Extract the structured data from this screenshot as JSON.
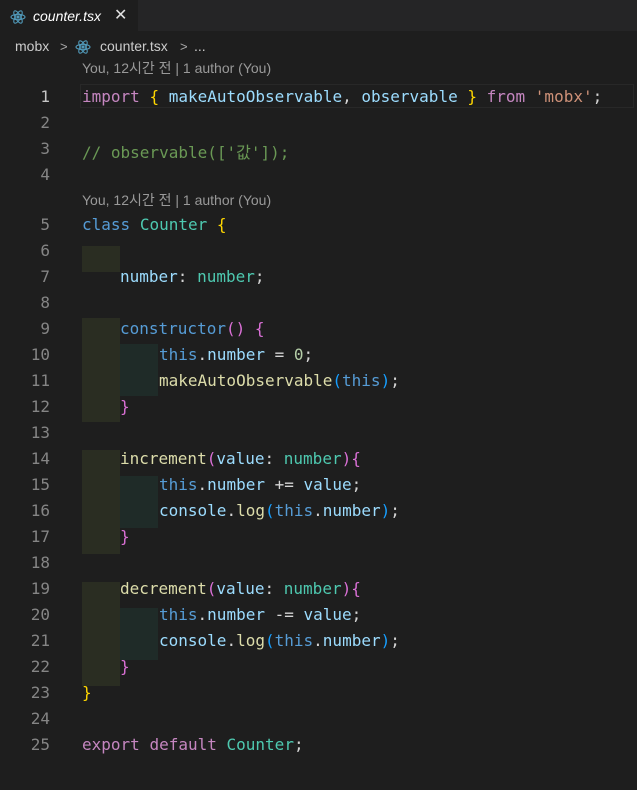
{
  "tab": {
    "label": "counter.tsx",
    "icon": "react-icon",
    "close": "✕"
  },
  "breadcrumb": {
    "folder": "mobx",
    "file": "counter.tsx",
    "more": "...",
    "sep": ">"
  },
  "codelens": "You, 12시간 전 | 1 author (You)",
  "lines": {
    "1": {
      "num": "1",
      "t": [
        "import",
        " ",
        "{",
        " ",
        "makeAutoObservable",
        ", ",
        "observable",
        " ",
        "}",
        " ",
        "from",
        " ",
        "'mobx'",
        ";"
      ]
    },
    "2": {
      "num": "2"
    },
    "3": {
      "num": "3",
      "t": [
        "// observable(['값']);"
      ]
    },
    "4": {
      "num": "4"
    },
    "5": {
      "num": "5",
      "t": [
        "class",
        " ",
        "Counter",
        " ",
        "{"
      ]
    },
    "6": {
      "num": "6"
    },
    "7": {
      "num": "7",
      "t": [
        "number",
        ": ",
        "number",
        ";"
      ]
    },
    "8": {
      "num": "8"
    },
    "9": {
      "num": "9",
      "t": [
        "constructor",
        "()",
        " ",
        "{"
      ]
    },
    "10": {
      "num": "10",
      "t": [
        "this",
        ".",
        "number",
        " = ",
        "0",
        ";"
      ]
    },
    "11": {
      "num": "11",
      "t": [
        "makeAutoObservable",
        "(",
        "this",
        ")",
        ";"
      ]
    },
    "12": {
      "num": "12",
      "t": [
        "}"
      ]
    },
    "13": {
      "num": "13"
    },
    "14": {
      "num": "14",
      "t": [
        "increment",
        "(",
        "value",
        ": ",
        "number",
        ")",
        "{"
      ]
    },
    "15": {
      "num": "15",
      "t": [
        "this",
        ".",
        "number",
        " += ",
        "value",
        ";"
      ]
    },
    "16": {
      "num": "16",
      "t": [
        "console",
        ".",
        "log",
        "(",
        "this",
        ".",
        "number",
        ")",
        ";"
      ]
    },
    "17": {
      "num": "17",
      "t": [
        "}"
      ]
    },
    "18": {
      "num": "18"
    },
    "19": {
      "num": "19",
      "t": [
        "decrement",
        "(",
        "value",
        ": ",
        "number",
        ")",
        "{"
      ]
    },
    "20": {
      "num": "20",
      "t": [
        "this",
        ".",
        "number",
        " -= ",
        "value",
        ";"
      ]
    },
    "21": {
      "num": "21",
      "t": [
        "console",
        ".",
        "log",
        "(",
        "this",
        ".",
        "number",
        ")",
        ";"
      ]
    },
    "22": {
      "num": "22",
      "t": [
        "}"
      ]
    },
    "23": {
      "num": "23",
      "t": [
        "}"
      ]
    },
    "24": {
      "num": "24"
    },
    "25": {
      "num": "25",
      "t": [
        "export",
        " ",
        "default",
        " ",
        "Counter",
        ";"
      ]
    }
  },
  "colors": {
    "background": "#1e1e1e",
    "keyword": "#c586c0",
    "storage": "#569cd6",
    "variable": "#9cdcfe",
    "type": "#4ec9b0",
    "function": "#dcdcaa",
    "string": "#ce9178",
    "number": "#b5cea8",
    "comment": "#6a9955"
  }
}
